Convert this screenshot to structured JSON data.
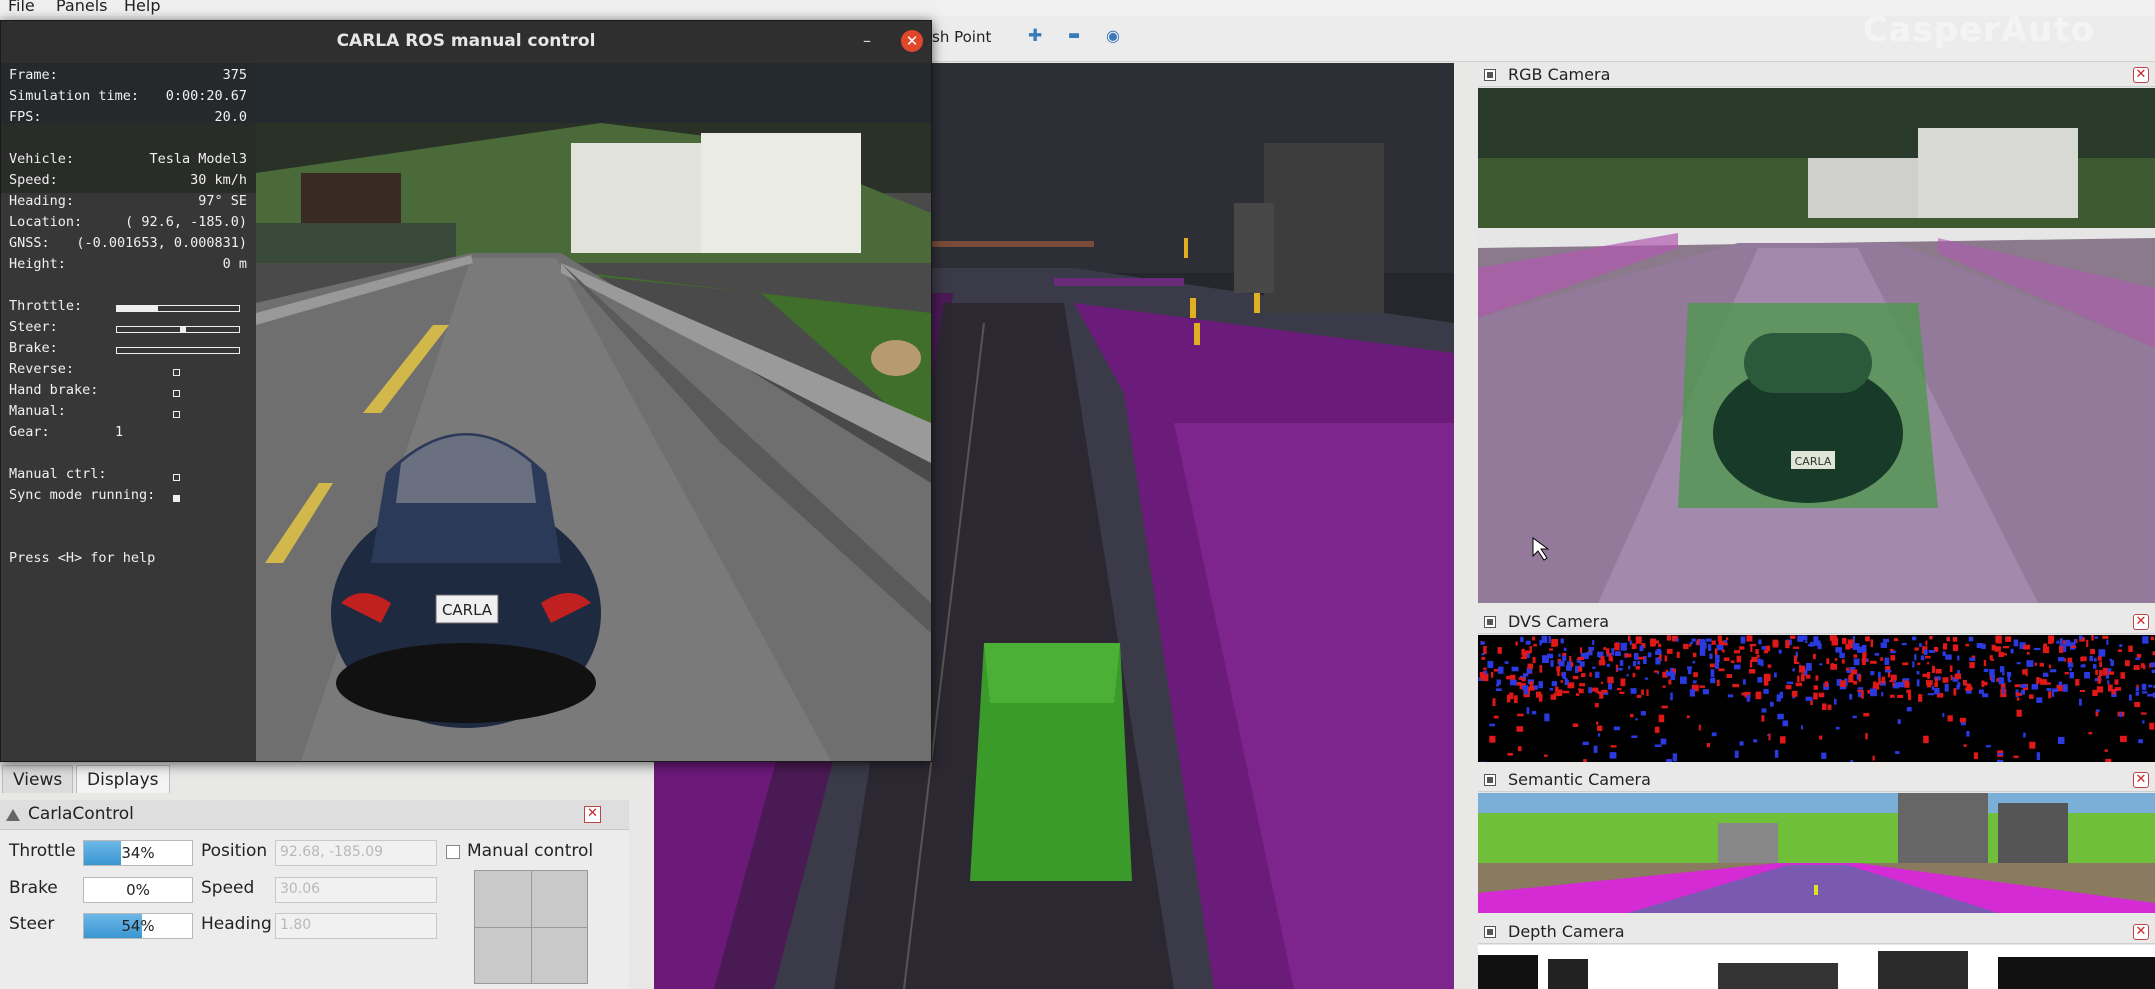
{
  "menubar": {
    "items": [
      "File",
      "Panels",
      "Help"
    ]
  },
  "toolbar": {
    "partial_button": "sh Point",
    "plus": "✚",
    "minus": "▬",
    "eye": "◉",
    "brand": "CasperAuto"
  },
  "carla_window": {
    "title": "CARLA ROS manual control",
    "minimize": "–",
    "close": "✕",
    "hud": {
      "frame_label": "Frame:",
      "frame": "375",
      "sim_time_label": "Simulation time:",
      "sim_time": "0:00:20.67",
      "fps_label": "FPS:",
      "fps": "20.0",
      "vehicle_label": "Vehicle:",
      "vehicle": "Tesla Model3",
      "speed_label": "Speed:",
      "speed": "30 km/h",
      "heading_label": "Heading:",
      "heading": "97° SE",
      "location_label": "Location:",
      "location": "( 92.6, -185.0)",
      "gnss_label": "GNSS:",
      "gnss": "(-0.001653, 0.000831)",
      "height_label": "Height:",
      "height": "0 m",
      "throttle_label": "Throttle:",
      "throttle_level": 0.34,
      "steer_label": "Steer:",
      "steer_level": 0.54,
      "brake_label": "Brake:",
      "brake_level": 0.0,
      "reverse_label": "Reverse:",
      "reverse": false,
      "hand_brake_label": "Hand brake:",
      "hand_brake": false,
      "manual_label": "Manual:",
      "manual": false,
      "gear_label": "Gear:",
      "gear": "1",
      "manual_ctrl_label": "Manual ctrl:",
      "manual_ctrl": false,
      "sync_label": "Sync mode running:",
      "sync": true,
      "help": "Press <H> for help"
    },
    "plate": "CARLA"
  },
  "panels": {
    "rgb": {
      "title": "RGB Camera",
      "plate": "CARLA"
    },
    "dvs": {
      "title": "DVS Camera"
    },
    "semantic": {
      "title": "Semantic Camera"
    },
    "depth": {
      "title": "Depth Camera"
    },
    "close": "✕"
  },
  "tabs": {
    "views": "Views",
    "displays": "Displays"
  },
  "carla_control": {
    "title": "CarlaControl",
    "close": "✕",
    "throttle_label": "Throttle",
    "throttle_value": "34%",
    "throttle_level": 0.34,
    "brake_label": "Brake",
    "brake_value": "0%",
    "brake_level": 0.0,
    "steer_label": "Steer",
    "steer_value": "54%",
    "steer_level": 0.54,
    "position_label": "Position",
    "position_value": "92.68, -185.09",
    "speed_label": "Speed",
    "speed_value": "30.06",
    "heading_label": "Heading",
    "heading_value": "1.80",
    "manual_control_label": "Manual control"
  },
  "colors": {
    "accent": "#3a96d2",
    "close_red": "#e0462a",
    "semantic_road": "#d42bd4",
    "vegetation": "#6fbf3a"
  }
}
